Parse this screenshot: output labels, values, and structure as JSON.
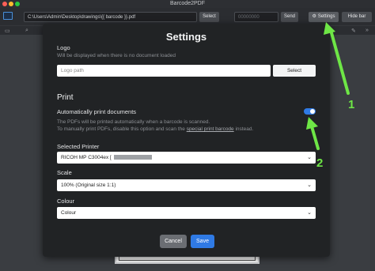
{
  "window": {
    "title": "Barcode2PDF"
  },
  "toolbar": {
    "path_value": "C:\\Users\\Admin\\Desktop\\drawings\\{{ barcode }}.pdf",
    "select_label": "Select",
    "number_placeholder": "00000000",
    "send_label": "Send",
    "settings_label": "Settings",
    "hide_bar_label": "Hide bar"
  },
  "modal": {
    "title": "Settings",
    "logo": {
      "label": "Logo",
      "hint": "Will be displayed when there is no document loaded",
      "placeholder": "Logo path",
      "select_label": "Select"
    },
    "print": {
      "heading": "Print",
      "auto_label": "Automatically print documents",
      "auto_enabled": true,
      "hint_line1": "The PDFs will be printed automatically when a barcode is scanned.",
      "hint_line2_prefix": "To manually print PDFs, disable this option and scan the",
      "hint_link": "special print barcode",
      "hint_line2_suffix": "instead."
    },
    "printer": {
      "label": "Selected Printer",
      "value": "RICOH MP C3004ex ["
    },
    "scale": {
      "label": "Scale",
      "value": "100% (Original size 1:1)"
    },
    "colour": {
      "label": "Colour",
      "value": "Colour"
    },
    "cancel_label": "Cancel",
    "save_label": "Save"
  },
  "annotations": {
    "one": "1",
    "two": "2",
    "color": "#6ee646"
  },
  "colors": {
    "accent": "#2f7ae5",
    "modal_bg": "#212325",
    "app_bg": "#3a3d41"
  }
}
